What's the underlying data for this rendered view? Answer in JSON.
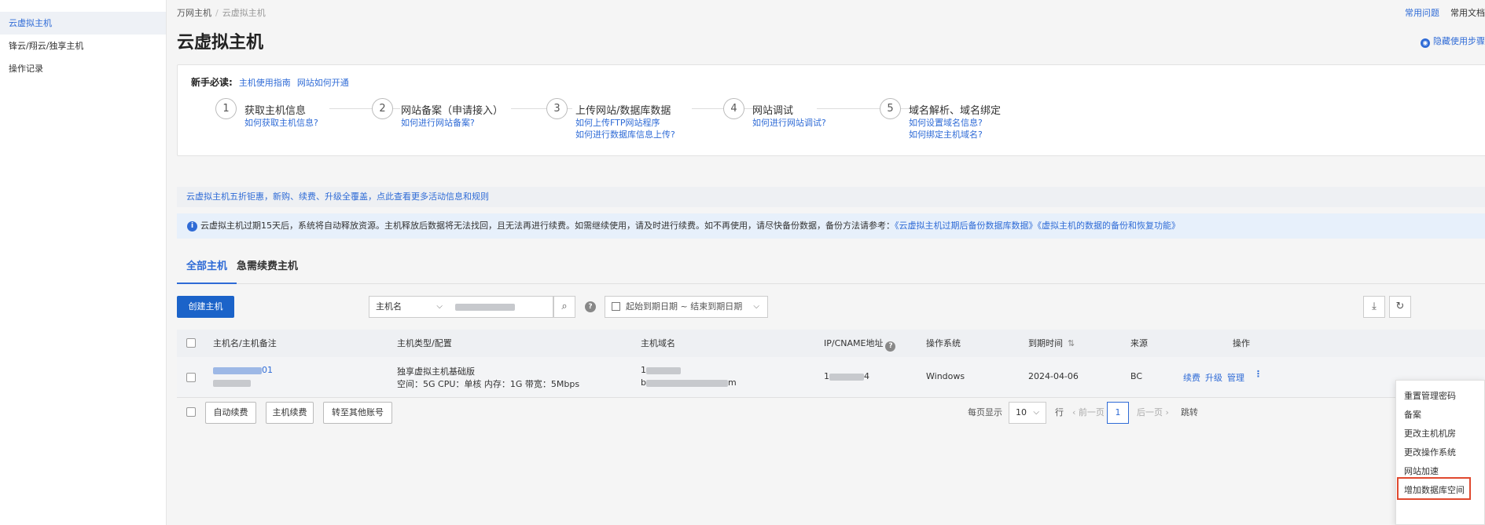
{
  "sidebar": {
    "items": [
      {
        "label": "云虚拟主机",
        "active": true
      },
      {
        "label": "锋云/翔云/独享主机",
        "active": false
      },
      {
        "label": "操作记录",
        "active": false
      }
    ]
  },
  "breadcrumb": {
    "root": "万网主机",
    "separator": "/",
    "current": "云虚拟主机"
  },
  "top_links": {
    "faq": "常用问题",
    "docs": "常用文档"
  },
  "page_title": "云虚拟主机",
  "hide_steps": "隐藏使用步骤",
  "guide": {
    "label": "新手必读:",
    "links": [
      "主机使用指南",
      "网站如何开通"
    ],
    "steps": [
      {
        "num": "1",
        "title": "获取主机信息",
        "subs": [
          "如何获取主机信息?"
        ]
      },
      {
        "num": "2",
        "title": "网站备案（申请接入）",
        "subs": [
          "如何进行网站备案?"
        ]
      },
      {
        "num": "3",
        "title": "上传网站/数据库数据",
        "subs": [
          "如何上传FTP网站程序",
          "如何进行数据库信息上传?"
        ]
      },
      {
        "num": "4",
        "title": "网站调试",
        "subs": [
          "如何进行网站调试?"
        ]
      },
      {
        "num": "5",
        "title": "域名解析、域名绑定",
        "subs": [
          "如何设置域名信息?",
          "如何绑定主机域名?"
        ]
      }
    ]
  },
  "promo_text": "云虚拟主机五折钜惠，新购、续费、升级全覆盖，点此查看更多活动信息和规则",
  "notice": {
    "text": "云虚拟主机过期15天后，系统将自动释放资源。主机释放后数据将无法找回，且无法再进行续费。如需继续使用，请及时进行续费。如不再使用，请尽快备份数据，备份方法请参考：",
    "link1": "《云虚拟主机过期后备份数据库数据》",
    "link2": "《虚拟主机的数据的备份和恢复功能》"
  },
  "tabs": [
    {
      "label": "全部主机",
      "active": true
    },
    {
      "label": "急需续费主机",
      "active": false
    }
  ],
  "toolbar": {
    "create_label": "创建主机",
    "filter_select": "主机名",
    "date_range": "起始到期日期 ~ 结束到期日期"
  },
  "table": {
    "headers": [
      "主机名/主机备注",
      "主机类型/配置",
      "主机域名",
      "IP/CNAME地址",
      "操作系统",
      "到期时间",
      "来源",
      "操作"
    ],
    "rows": [
      {
        "name_suffix": "01",
        "type": "独享虚拟主机基础版",
        "config": "空间：5G CPU：单核 内存：1G 带宽：5Mbps",
        "domain_prefix": "1",
        "domain_line2_prefix": "b",
        "domain_line2_suffix": "m",
        "ip_prefix": "1",
        "ip_suffix": "4",
        "os": "Windows",
        "expire": "2024-04-06",
        "source": "BC",
        "ops": [
          "续费",
          "升级",
          "管理"
        ]
      }
    ]
  },
  "bottom": {
    "buttons": [
      "自动续费",
      "主机续费",
      "转至其他账号"
    ],
    "per_page_label": "每页显示",
    "per_page_value": "10",
    "row_unit": "行",
    "prev": "前一页",
    "current_page": "1",
    "next": "后一页",
    "jump": "跳转"
  },
  "menu": {
    "items": [
      "重置管理密码",
      "备案",
      "更改主机机房",
      "更改操作系统",
      "网站加速",
      "增加数据库空间"
    ],
    "highlighted": "增加数据库空间"
  },
  "colors": {
    "accent": "#2f6bd6",
    "primary_button": "#1b63c9",
    "highlight_border": "#e0492f"
  }
}
